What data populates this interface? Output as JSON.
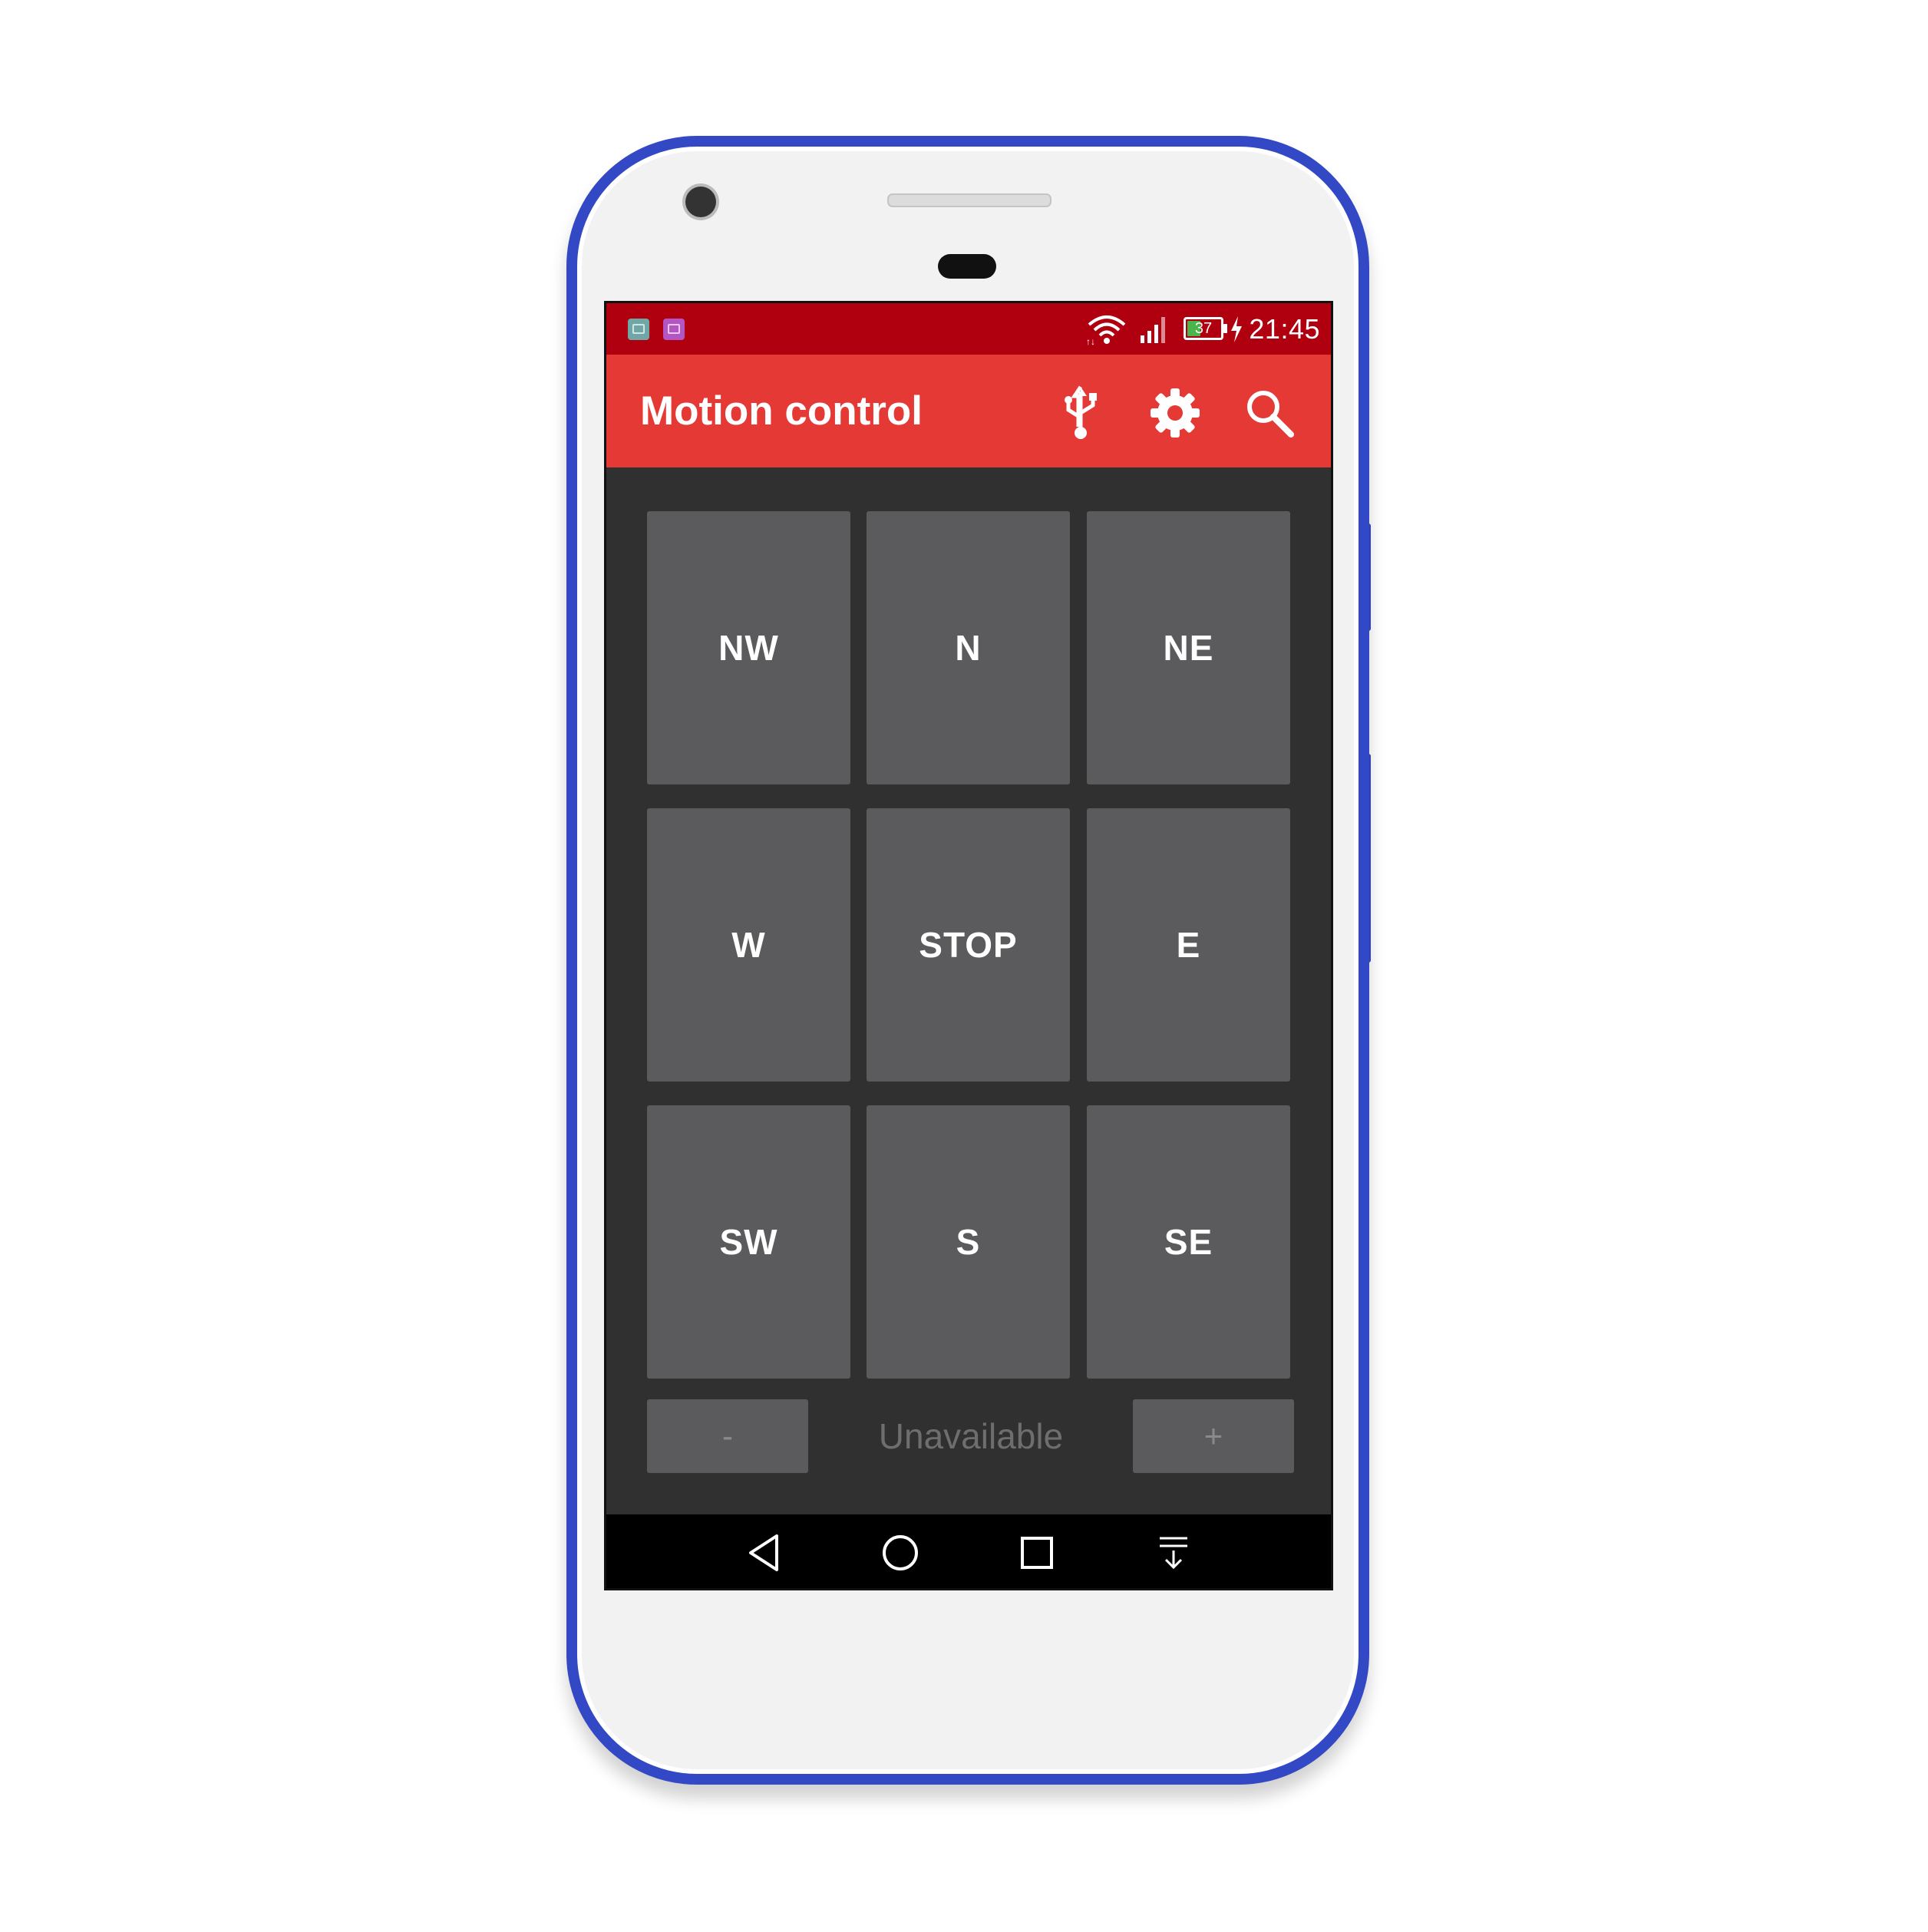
{
  "status_bar": {
    "time": "21:45",
    "battery_level": "37",
    "battery_charging": true,
    "notification_icons": [
      "android-debug-icon",
      "image-icon"
    ],
    "icons": [
      "wifi-icon",
      "signal-icon",
      "battery-icon",
      "charging-icon"
    ],
    "color": "#b0000f"
  },
  "app_bar": {
    "title": "Motion control",
    "actions": [
      "usb-icon",
      "settings-icon",
      "search-icon"
    ],
    "color": "#e53935"
  },
  "direction_pad": {
    "buttons": [
      {
        "label": "NW"
      },
      {
        "label": "N"
      },
      {
        "label": "NE"
      },
      {
        "label": "W"
      },
      {
        "label": "STOP"
      },
      {
        "label": "E"
      },
      {
        "label": "SW"
      },
      {
        "label": "S"
      },
      {
        "label": "SE"
      }
    ],
    "button_color": "#5b5b5d"
  },
  "speed_control": {
    "decrease_label": "-",
    "value": "Unavailable",
    "increase_label": "+"
  },
  "nav_bar": {
    "buttons": [
      "back-icon",
      "home-icon",
      "recents-icon",
      "notifications-pull-icon"
    ]
  },
  "device": {
    "frame_color": "#3348c4"
  }
}
